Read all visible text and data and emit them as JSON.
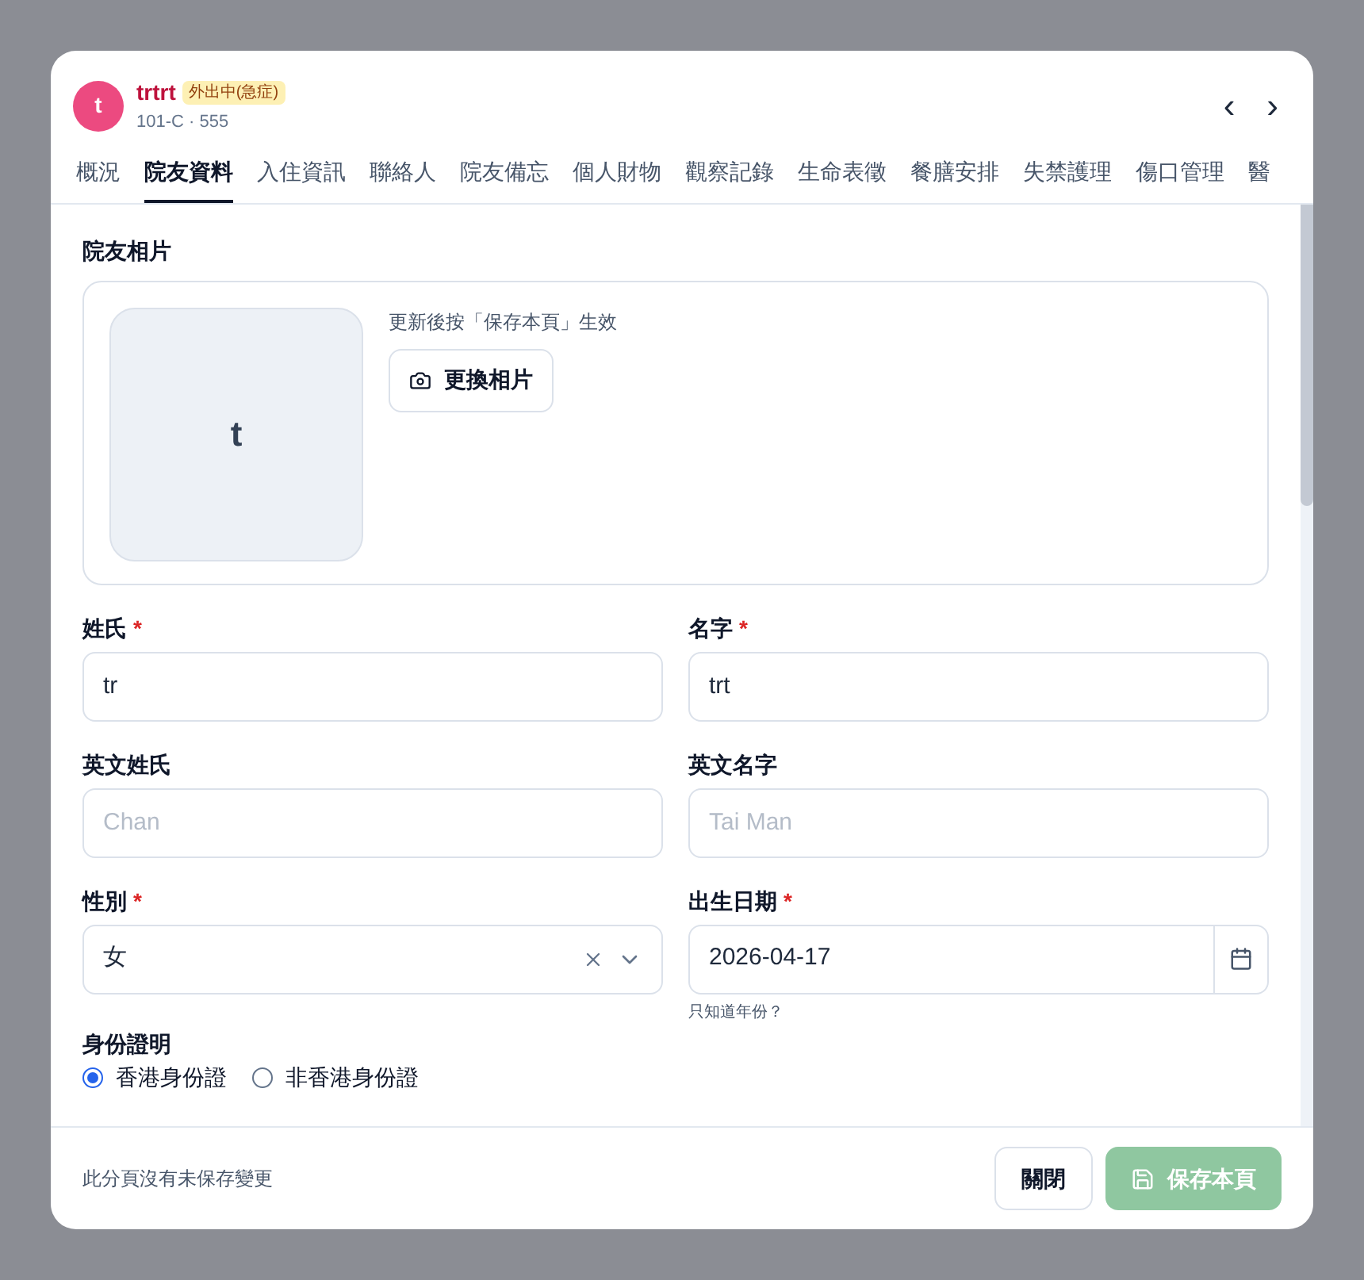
{
  "header": {
    "avatar": "t",
    "name": "trtrt",
    "status": "外出中(急症)",
    "subtitle": "101-C · 555",
    "prev": "‹",
    "next": "›"
  },
  "tabs": [
    {
      "label": "概況",
      "selected": false
    },
    {
      "label": "院友資料",
      "selected": true
    },
    {
      "label": "入住資訊",
      "selected": false
    },
    {
      "label": "聯絡人",
      "selected": false
    },
    {
      "label": "院友備忘",
      "selected": false
    },
    {
      "label": "個人財物",
      "selected": false
    },
    {
      "label": "觀察記錄",
      "selected": false
    },
    {
      "label": "生命表徵",
      "selected": false
    },
    {
      "label": "餐膳安排",
      "selected": false
    },
    {
      "label": "失禁護理",
      "selected": false
    },
    {
      "label": "傷口管理",
      "selected": false
    },
    {
      "label": "醫",
      "selected": false
    }
  ],
  "photo": {
    "title": "院友相片",
    "initial": "t",
    "hint": "更新後按「保存本頁」生效",
    "button": "更換相片"
  },
  "fields": [
    {
      "label": "姓氏",
      "required_mark": "*",
      "kind": "text",
      "value": "tr"
    },
    {
      "label": "名字",
      "required_mark": "*",
      "kind": "text",
      "value": "trt"
    },
    {
      "label": "英文姓氏",
      "kind": "text",
      "placeholder": "Chan"
    },
    {
      "label": "英文名字",
      "kind": "text",
      "placeholder": "Tai Man"
    },
    {
      "label": "性別",
      "required_mark": "*",
      "kind": "select",
      "value": "女"
    },
    {
      "label": "出生日期",
      "required_mark": "*",
      "kind": "date",
      "value": "2026-04-17",
      "help": "只知道年份？"
    }
  ],
  "id_type": {
    "label": "身份證明",
    "options": [
      {
        "label": "香港身份證",
        "selected": true
      },
      {
        "label": "非香港身份證",
        "selected": false
      }
    ]
  },
  "footer": {
    "status": "此分頁沒有未保存變更",
    "close": "關閉",
    "save": "保存本頁"
  }
}
